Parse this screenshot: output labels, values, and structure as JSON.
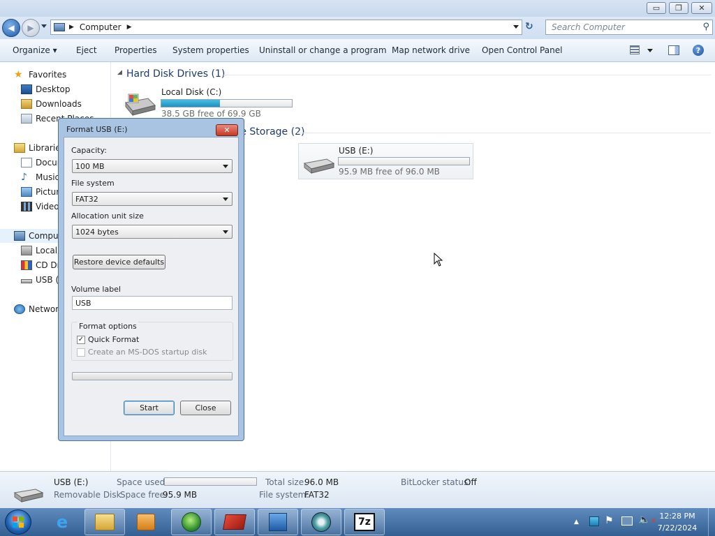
{
  "window": {
    "minimize": "▭",
    "maximize": "❐",
    "close": "✕"
  },
  "address": {
    "breadcrumb": [
      "Computer"
    ],
    "search_placeholder": "Search Computer"
  },
  "toolbar": [
    "Organize ▾",
    "Eject",
    "Properties",
    "System properties",
    "Uninstall or change a program",
    "Map network drive",
    "Open Control Panel"
  ],
  "nav": {
    "favorites": "Favorites",
    "fav_items": [
      "Desktop",
      "Downloads",
      "Recent Places"
    ],
    "libraries": "Libraries",
    "lib_items": [
      "Documents",
      "Music",
      "Pictures",
      "Videos"
    ],
    "computer": "Computer",
    "comp_items": [
      "Local Disk (C:)",
      "CD Drive (D:)",
      "USB (E:)"
    ],
    "network": "Network"
  },
  "content": {
    "group1": "Hard Disk Drives (1)",
    "group2": "Devices with Removable Storage (2)",
    "drive_c": {
      "name": "Local Disk (C:)",
      "free": "38.5 GB free of 69.9 GB",
      "used_fraction": 0.45
    },
    "drive_e": {
      "name": "USB (E:)",
      "free": "95.9 MB free of 96.0 MB",
      "used_fraction": 0.001
    }
  },
  "dialog": {
    "title": "Format USB (E:)",
    "capacity_label": "Capacity:",
    "capacity_value": "100 MB",
    "fs_label": "File system",
    "fs_value": "FAT32",
    "alloc_label": "Allocation unit size",
    "alloc_value": "1024 bytes",
    "restore": "Restore device defaults",
    "volume_label": "Volume label",
    "volume_value": "USB",
    "options_label": "Format options",
    "quick_format": "Quick Format",
    "msdos": "Create an MS-DOS startup disk",
    "start": "Start",
    "close": "Close",
    "progress": 0
  },
  "details": {
    "name": "USB (E:)",
    "type": "Removable Disk",
    "space_used_label": "Space used:",
    "space_free_label": "Space free:",
    "space_free": "95.9 MB",
    "total_label": "Total size:",
    "total": "96.0 MB",
    "fs_label": "File system:",
    "fs": "FAT32",
    "bitlocker_label": "BitLocker status:",
    "bitlocker": "Off"
  },
  "taskbar": {
    "time": "12:28 PM",
    "date": "7/22/2024",
    "apps": [
      "explorer",
      "media-center",
      "idm",
      "winrar",
      "network",
      "disk-manager",
      "7zip"
    ]
  }
}
